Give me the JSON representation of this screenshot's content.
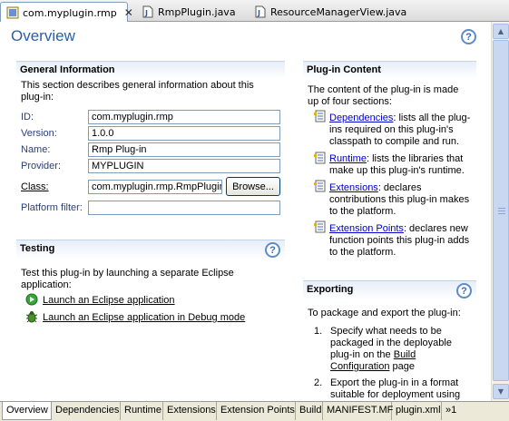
{
  "editor_tabs": [
    {
      "label": "com.myplugin.rmp",
      "active": true
    },
    {
      "label": "RmpPlugin.java",
      "active": false
    },
    {
      "label": "ResourceManagerView.java",
      "active": false
    }
  ],
  "page": {
    "title": "Overview",
    "help": "?"
  },
  "general": {
    "title": "General Information",
    "desc": "This section describes general information about this plug-in:",
    "fields": {
      "id": {
        "label": "ID:",
        "value": "com.myplugin.rmp"
      },
      "version": {
        "label": "Version:",
        "value": "1.0.0"
      },
      "name": {
        "label": "Name:",
        "value": "Rmp Plug-in"
      },
      "provider": {
        "label": "Provider:",
        "value": "MYPLUGIN"
      },
      "class": {
        "label": "Class:",
        "value": "com.myplugin.rmp.RmpPlugin"
      },
      "platform": {
        "label": "Platform filter:",
        "value": ""
      }
    },
    "browse": "Browse..."
  },
  "testing": {
    "title": "Testing",
    "help": "?",
    "desc": "Test this plug-in by launching a separate Eclipse application:",
    "launch": "Launch an Eclipse application",
    "debug": "Launch an Eclipse application in Debug mode"
  },
  "content": {
    "title": "Plug-in Content",
    "desc": "The content of the plug-in is made up of four sections:",
    "items": [
      {
        "link": "Dependencies",
        "text": ": lists all the plug-ins required on this plug-in's classpath to compile and run."
      },
      {
        "link": "Runtime",
        "text": ": lists the libraries that make up this plug-in's runtime."
      },
      {
        "link": "Extensions",
        "text": ": declares contributions this plug-in makes to the platform."
      },
      {
        "link": "Extension Points",
        "text": ": declares new function points this plug-in adds to the platform."
      }
    ]
  },
  "exporting": {
    "title": "Exporting",
    "help": "?",
    "desc": "To package and export the plug-in:",
    "step1_num": "1.",
    "step1_a": "Specify what needs to be packaged in the deployable plug-in on the",
    "step1_link": "Build Configuration",
    "step1_b": "page",
    "step2_num": "2.",
    "step2": "Export the plug-in in a format suitable for deployment using"
  },
  "bottom_tabs": [
    "Overview",
    "Dependencies",
    "Runtime",
    "Extensions",
    "Extension Points",
    "Build",
    "MANIFEST.MF",
    "plugin.xml",
    "»1"
  ],
  "colors": {
    "title": "#2a5ea6",
    "link": "#0000cc"
  }
}
